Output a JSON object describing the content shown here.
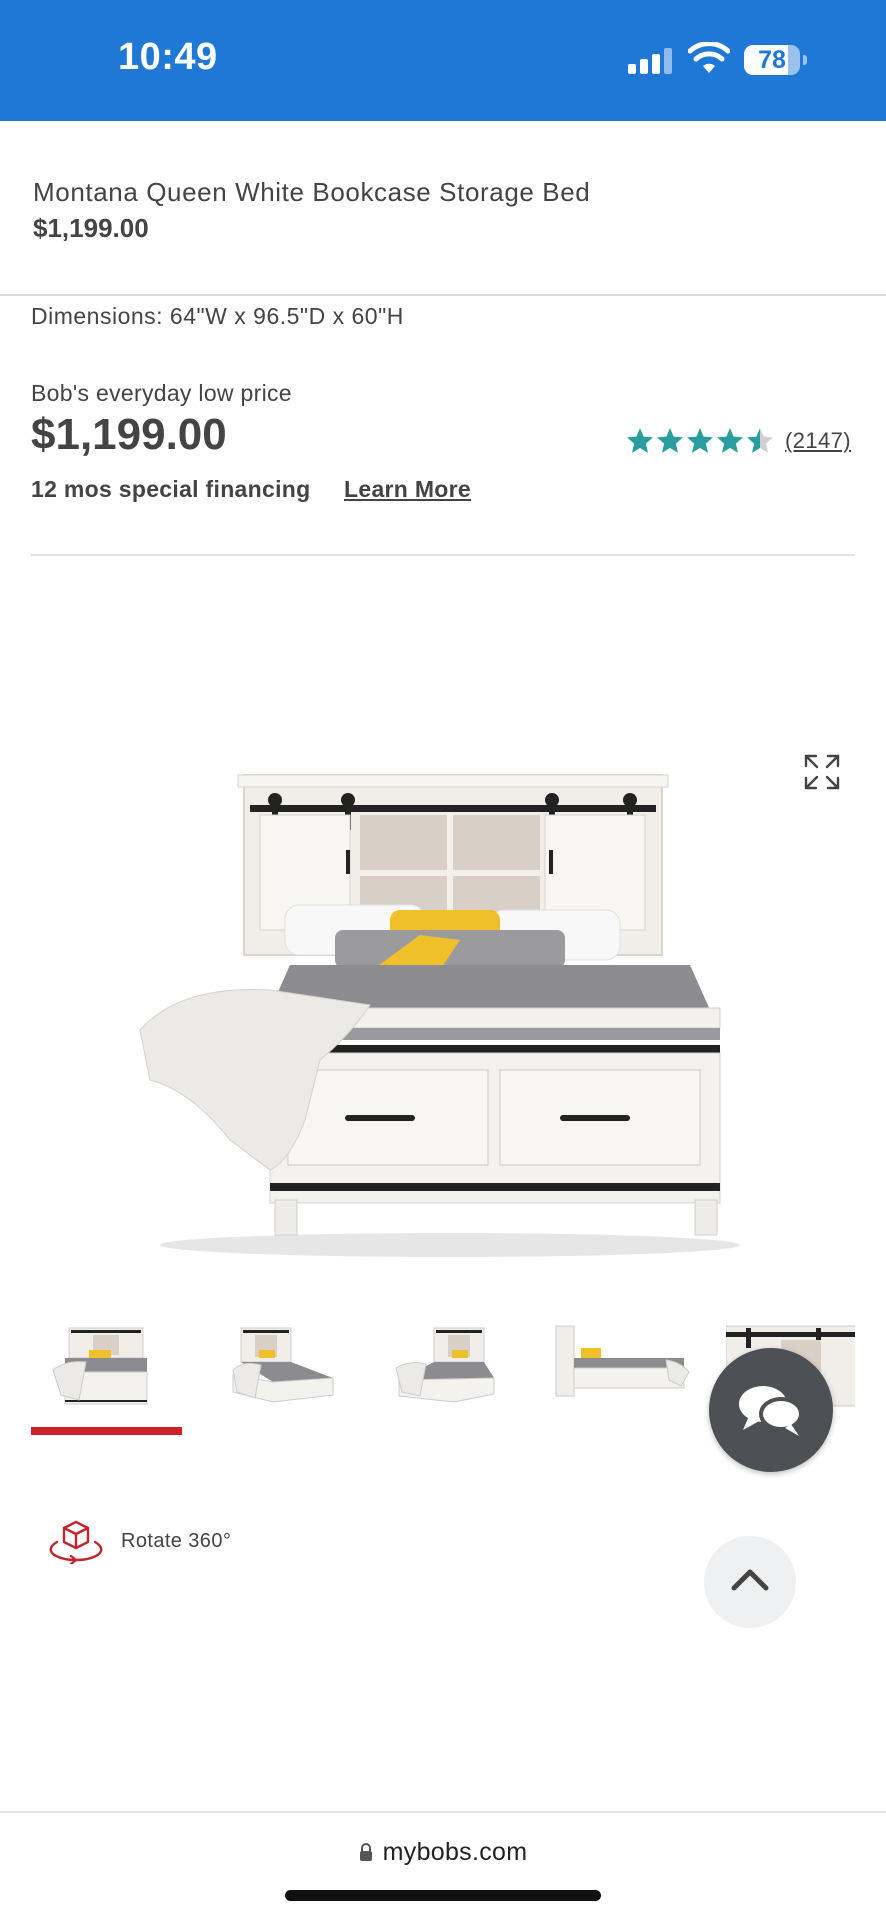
{
  "status_bar": {
    "time": "10:49",
    "battery": "78",
    "battery_level": 0.78,
    "icons": [
      "signal-icon",
      "wifi-icon",
      "battery-icon"
    ]
  },
  "sticky_header": {
    "title": "Montana Queen White Bookcase Storage Bed",
    "price": "$1,199.00"
  },
  "product": {
    "dimensions": "Dimensions: 64\"W x 96.5\"D x 60\"H",
    "price_label": "Bob's everyday low price",
    "price": "$1,199.00",
    "rating": 4.5,
    "review_count": "(2147)",
    "financing": "12 mos special financing",
    "learn_more": "Learn More"
  },
  "gallery": {
    "selected_index": 0,
    "thumbnails": [
      "front",
      "angle-left",
      "angle-right",
      "side",
      "detail"
    ]
  },
  "rotate": {
    "label": "Rotate 360°"
  },
  "browser": {
    "url": "mybobs.com"
  },
  "colors": {
    "status_bar": "#1f78d6",
    "star": "#2a9d9f",
    "active_thumb": "#cc2229",
    "chat_button": "#4d5055",
    "text": "#444444"
  }
}
